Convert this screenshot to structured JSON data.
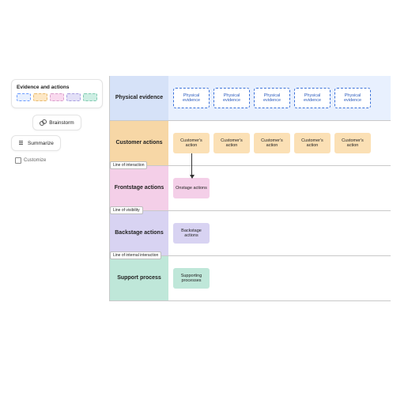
{
  "palette": {
    "title": "Evidence and actions"
  },
  "toolbar": {
    "brainstorm": "Brainstorm",
    "summarize": "Summarize",
    "customize": "Customize"
  },
  "blueprint": {
    "rows": [
      {
        "key": "evidence",
        "label": "Physical evidence",
        "card_label": "Physical evidence",
        "card_style": "evidence",
        "count": 5
      },
      {
        "key": "customer",
        "label": "Customer actions",
        "card_label": "Customer's action",
        "card_style": "orange",
        "count": 5,
        "divider_after": "Line of interaction"
      },
      {
        "key": "frontstage",
        "label": "Frontstage actions",
        "card_label": "Onstage actions",
        "card_style": "pink",
        "count": 1,
        "divider_after": "Line of visibility"
      },
      {
        "key": "backstage",
        "label": "Backstage actions",
        "card_label": "Backstage actions",
        "card_style": "purple",
        "count": 1,
        "divider_after": "Line of internal interaction"
      },
      {
        "key": "support",
        "label": "Support process",
        "card_label": "Supporting processes",
        "card_style": "teal",
        "count": 1
      }
    ],
    "arrow": {
      "from_row": "customer",
      "to_row": "frontstage",
      "column": 0
    }
  }
}
